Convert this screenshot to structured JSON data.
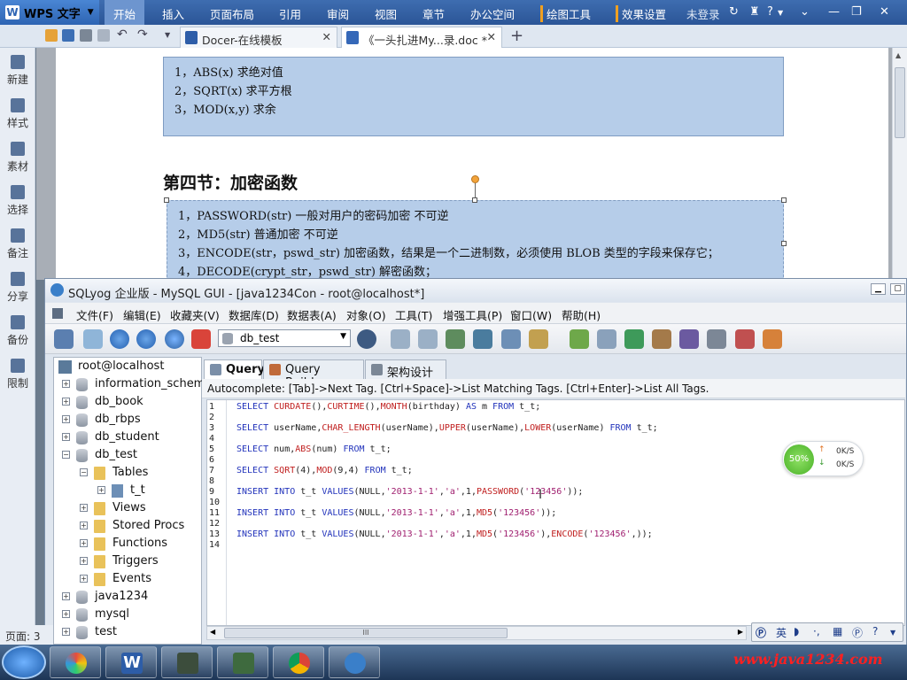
{
  "wps": {
    "app_name": "WPS 文字",
    "menus": [
      "开始",
      "插入",
      "页面布局",
      "引用",
      "审阅",
      "视图",
      "章节",
      "办公空间"
    ],
    "draw_tool_tab": "绘图工具",
    "effect_tab": "效果设置",
    "login_status": "未登录",
    "tabs": [
      {
        "label": "Docer-在线模板"
      },
      {
        "label": "《一头扎进My...录.doc *"
      }
    ],
    "sidebar": [
      "新建",
      "样式",
      "素材",
      "选择",
      "备注",
      "分享",
      "备份",
      "限制"
    ],
    "status_page": "页面: 3"
  },
  "doc": {
    "box1": [
      "1，ABS(x)      求绝对值",
      "2，SQRT(x)     求平方根",
      "3，MOD(x,y)    求余"
    ],
    "section_heading": "第四节：加密函数",
    "box2": [
      "1，PASSWORD(str)   一般对用户的密码加密     不可逆",
      "2，MD5(str)    普通加密  不可逆",
      "3，ENCODE(str，pswd_str)   加密函数，结果是一个二进制数，必须使用 BLOB 类型的字段来保存它；",
      "4，DECODE(crypt_str，pswd_str)    解密函数；"
    ]
  },
  "sqlyog": {
    "title": "SQLyog 企业版 - MySQL GUI - [java1234Con - root@localhost*]",
    "menus": [
      "文件(F)",
      "编辑(E)",
      "收藏夹(V)",
      "数据库(D)",
      "数据表(A)",
      "对象(O)",
      "工具(T)",
      "增强工具(P)",
      "窗口(W)",
      "帮助(H)"
    ],
    "db_selected": "db_test",
    "tree": {
      "root": "root@localhost",
      "dbs": [
        "information_schema",
        "db_book",
        "db_rbps",
        "db_student",
        "db_test"
      ],
      "db_test_children": [
        "Tables",
        "t_t",
        "Views",
        "Stored Procs",
        "Functions",
        "Triggers",
        "Events"
      ],
      "other_dbs": [
        "java1234",
        "mysql",
        "test"
      ]
    },
    "tabs": [
      "Query",
      "Query Builder",
      "架构设计器"
    ],
    "autocomplete": "Autocomplete: [Tab]->Next Tag. [Ctrl+Space]->List Matching Tags. [Ctrl+Enter]->List All Tags.",
    "line_numbers": [
      "1",
      "2",
      "3",
      "4",
      "5",
      "6",
      "7",
      "8",
      "9",
      "10",
      "11",
      "12",
      "13",
      "14"
    ],
    "code": {
      "l1": {
        "a": "SELECT ",
        "b": "CURDATE",
        "c": "(),",
        "d": "CURTIME",
        "e": "(),",
        "f": "MONTH",
        "g": "(birthday) ",
        "h": "AS",
        "i": " m ",
        "j": "FROM",
        "k": " t_t;"
      },
      "l3": {
        "a": "SELECT ",
        "b": "userName,",
        "c": "CHAR_LENGTH",
        "d": "(userName),",
        "e": "UPPER",
        "f": "(userName),",
        "g": "LOWER",
        "h": "(userName) ",
        "i": "FROM",
        "j": " t_t;"
      },
      "l5": {
        "a": "SELECT ",
        "b": "num,",
        "c": "ABS",
        "d": "(num) ",
        "e": "FROM",
        "f": " t_t;"
      },
      "l7": {
        "a": "SELECT ",
        "b": "SQRT",
        "c": "(4),",
        "d": "MOD",
        "e": "(9,4) ",
        "f": "FROM",
        "g": " t_t;"
      },
      "l9": {
        "a": "INSERT INTO",
        "b": " t_t ",
        "c": "VALUES",
        "d": "(NULL,",
        "e": "'2013-1-1'",
        "f": ",",
        "g": "'a'",
        "h": ",1,",
        "i": "PASSWORD",
        "j": "(",
        "k": "'123456'",
        "l": "));"
      },
      "l11": {
        "a": "INSERT INTO",
        "b": " t_t ",
        "c": "VALUES",
        "d": "(NULL,",
        "e": "'2013-1-1'",
        "f": ",",
        "g": "'a'",
        "h": ",1,",
        "i": "MD5",
        "j": "(",
        "k": "'123456'",
        "l": "));"
      },
      "l13": {
        "a": "INSERT INTO",
        "b": " t_t ",
        "c": "VALUES",
        "d": "(NULL,",
        "e": "'2013-1-1'",
        "f": ",",
        "g": "'a'",
        "h": ",1,",
        "i": "MD5",
        "j": "(",
        "k": "'123456'",
        "l": "),",
        "m": "ENCODE",
        "n": "(",
        "o": "'123456'",
        "p": ",));"
      }
    },
    "hscroll_grip": "III"
  },
  "net": {
    "percent": "50%",
    "up": "0K/S",
    "down": "0K/S"
  },
  "ime": {
    "lang": "英"
  },
  "watermark": "www.java1234.com"
}
